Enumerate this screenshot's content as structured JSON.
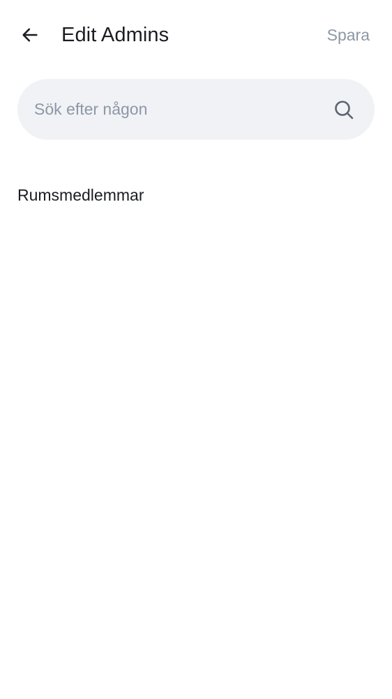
{
  "header": {
    "title": "Edit Admins",
    "save_label": "Spara",
    "back_icon": "arrow-left-icon"
  },
  "search": {
    "placeholder": "Sök efter någon",
    "value": "",
    "icon": "search-icon"
  },
  "members": {
    "section_title": "Rumsmedlemmar",
    "items": []
  },
  "colors": {
    "background": "#ffffff",
    "text_primary": "#1b1d22",
    "text_secondary": "#8d97a5",
    "search_background": "#f0f2f5"
  }
}
